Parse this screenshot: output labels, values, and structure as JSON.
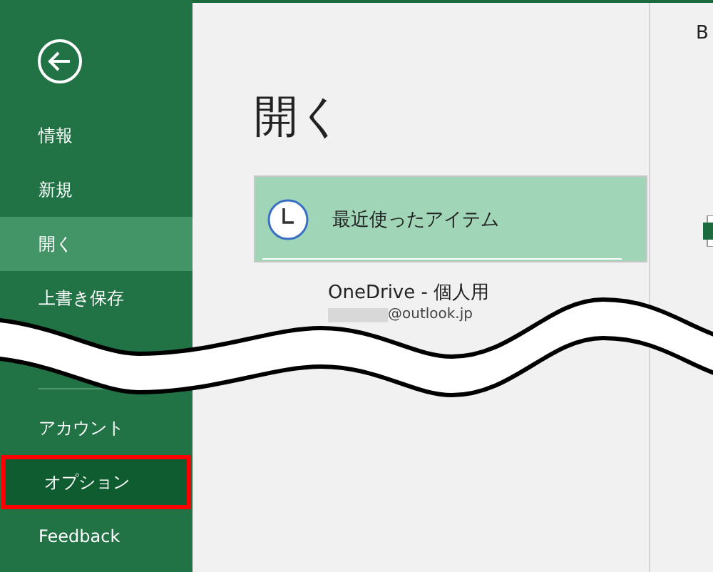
{
  "sidebar": {
    "items": [
      {
        "label": "情報",
        "selected": false,
        "outlined": false
      },
      {
        "label": "新規",
        "selected": false,
        "outlined": false
      },
      {
        "label": "開く",
        "selected": true,
        "outlined": false
      },
      {
        "label": "上書き保存",
        "selected": false,
        "outlined": false
      }
    ],
    "bottom_items": [
      {
        "label": "アカウント",
        "selected": false,
        "outlined": false
      },
      {
        "label": "オプション",
        "selected": false,
        "outlined": true
      },
      {
        "label": "Feedback",
        "selected": false,
        "outlined": false
      }
    ]
  },
  "main": {
    "title": "開く",
    "locations": [
      {
        "kind": "recent",
        "label": "最近使ったアイテム",
        "selected": true
      },
      {
        "kind": "cloud",
        "label": "OneDrive - 個人用",
        "account": "@outlook.jp",
        "selected": false
      }
    ]
  },
  "right_pane": {
    "header": "B"
  }
}
